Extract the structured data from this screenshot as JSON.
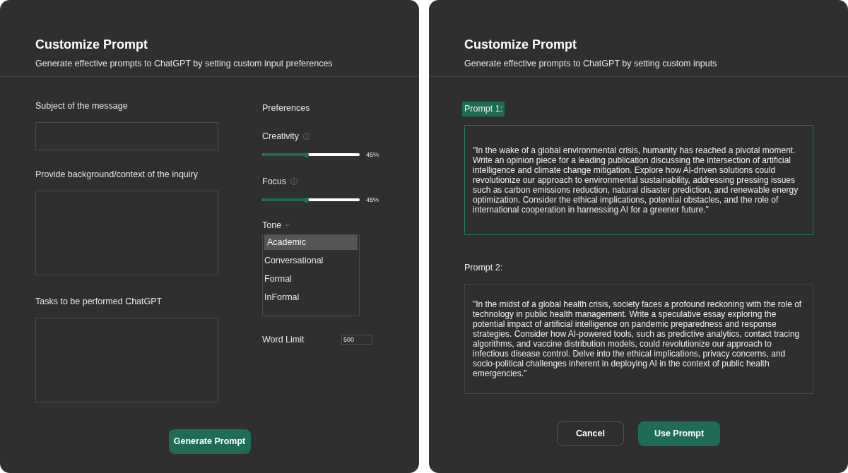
{
  "left_panel": {
    "title": "Customize Prompt",
    "subtitle": "Generate effective prompts to ChatGPT by setting custom input preferences",
    "fields": [
      {
        "label": "Subject of the message",
        "kind": "input"
      },
      {
        "label": "Provide background/context of the inquiry",
        "kind": "textarea"
      },
      {
        "label": "Tasks to be performed ChatGPT",
        "kind": "textarea"
      }
    ],
    "preferences": {
      "heading": "Preferences",
      "sliders": [
        {
          "label": "Creativity",
          "level": 0.45,
          "reading": "45%"
        },
        {
          "label": "Focus",
          "level": 0.45,
          "reading": "45%"
        }
      ],
      "tone": {
        "label": "Tone",
        "options": [
          {
            "label": "Academic",
            "selected": true
          },
          {
            "label": "Conversational",
            "selected": false
          },
          {
            "label": "Formal",
            "selected": false
          },
          {
            "label": "InFormal",
            "selected": false
          }
        ]
      },
      "word_limit": {
        "label": "Word Limit",
        "value": "500"
      }
    },
    "generate_button": "Generate Prompt"
  },
  "right_panel": {
    "title": "Customize Prompt",
    "subtitle": "Generate effective prompts to ChatGPT by setting custom inputs",
    "prompts": [
      {
        "label": "Prompt 1:",
        "selected": true,
        "text": "\"In the wake of a global environmental crisis, humanity has reached a pivotal moment. Write an opinion piece for a leading publication discussing the intersection of artificial intelligence and climate change mitigation. Explore how AI-driven solutions could revolutionize our approach to environmental sustainability, addressing pressing issues such as carbon emissions reduction, natural disaster prediction, and renewable energy optimization. Consider the ethical implications, potential obstacles, and the role of international cooperation in harnessing AI for a greener future.\""
      },
      {
        "label": "Prompt 2:",
        "selected": false,
        "text": "\"In the midst of a global health crisis, society faces a profound reckoning with the role of technology in public health management. Write a speculative essay exploring the potential impact of artificial intelligence on pandemic preparedness and response strategies. Consider how AI-powered tools, such as predictive analytics, contact tracing algorithms, and vaccine distribution models, could revolutionize our approach to infectious disease control. Delve into the ethical implications, privacy concerns, and socio-political challenges inherent in deploying AI in the context of public health emergencies.\""
      }
    ],
    "buttons": [
      {
        "label": "Cancel",
        "kind": "secondary"
      },
      {
        "label": "Use Prompt",
        "kind": "primary"
      }
    ]
  }
}
